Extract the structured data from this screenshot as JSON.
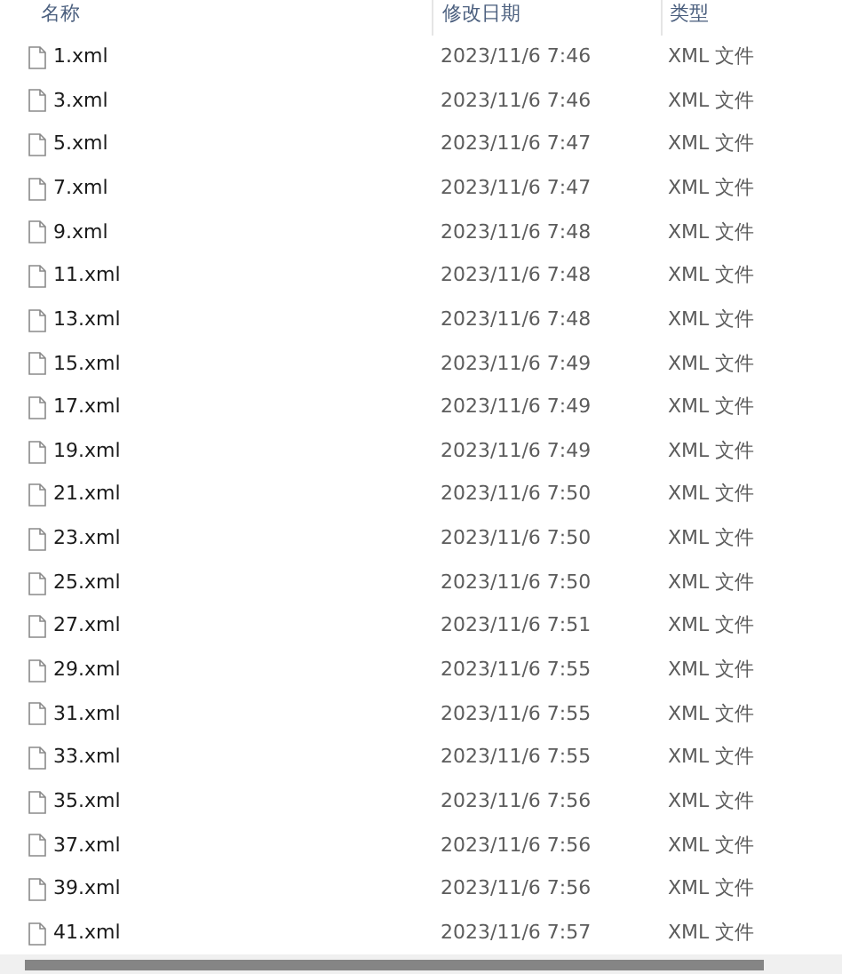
{
  "columns": [
    "名称",
    "修改日期",
    "类型"
  ],
  "rows": [
    {
      "name": "1.xml",
      "date": "2023/11/6 7:46",
      "type": "XML 文件"
    },
    {
      "name": "3.xml",
      "date": "2023/11/6 7:46",
      "type": "XML 文件"
    },
    {
      "name": "5.xml",
      "date": "2023/11/6 7:47",
      "type": "XML 文件"
    },
    {
      "name": "7.xml",
      "date": "2023/11/6 7:47",
      "type": "XML 文件"
    },
    {
      "name": "9.xml",
      "date": "2023/11/6 7:48",
      "type": "XML 文件"
    },
    {
      "name": "11.xml",
      "date": "2023/11/6 7:48",
      "type": "XML 文件"
    },
    {
      "name": "13.xml",
      "date": "2023/11/6 7:48",
      "type": "XML 文件"
    },
    {
      "name": "15.xml",
      "date": "2023/11/6 7:49",
      "type": "XML 文件"
    },
    {
      "name": "17.xml",
      "date": "2023/11/6 7:49",
      "type": "XML 文件"
    },
    {
      "name": "19.xml",
      "date": "2023/11/6 7:49",
      "type": "XML 文件"
    },
    {
      "name": "21.xml",
      "date": "2023/11/6 7:50",
      "type": "XML 文件"
    },
    {
      "name": "23.xml",
      "date": "2023/11/6 7:50",
      "type": "XML 文件"
    },
    {
      "name": "25.xml",
      "date": "2023/11/6 7:50",
      "type": "XML 文件"
    },
    {
      "name": "27.xml",
      "date": "2023/11/6 7:51",
      "type": "XML 文件"
    },
    {
      "name": "29.xml",
      "date": "2023/11/6 7:55",
      "type": "XML 文件"
    },
    {
      "name": "31.xml",
      "date": "2023/11/6 7:55",
      "type": "XML 文件"
    },
    {
      "name": "33.xml",
      "date": "2023/11/6 7:55",
      "type": "XML 文件"
    },
    {
      "name": "35.xml",
      "date": "2023/11/6 7:56",
      "type": "XML 文件"
    },
    {
      "name": "37.xml",
      "date": "2023/11/6 7:56",
      "type": "XML 文件"
    },
    {
      "name": "39.xml",
      "date": "2023/11/6 7:56",
      "type": "XML 文件"
    },
    {
      "name": "41.xml",
      "date": "2023/11/6 7:57",
      "type": "XML 文件"
    }
  ]
}
